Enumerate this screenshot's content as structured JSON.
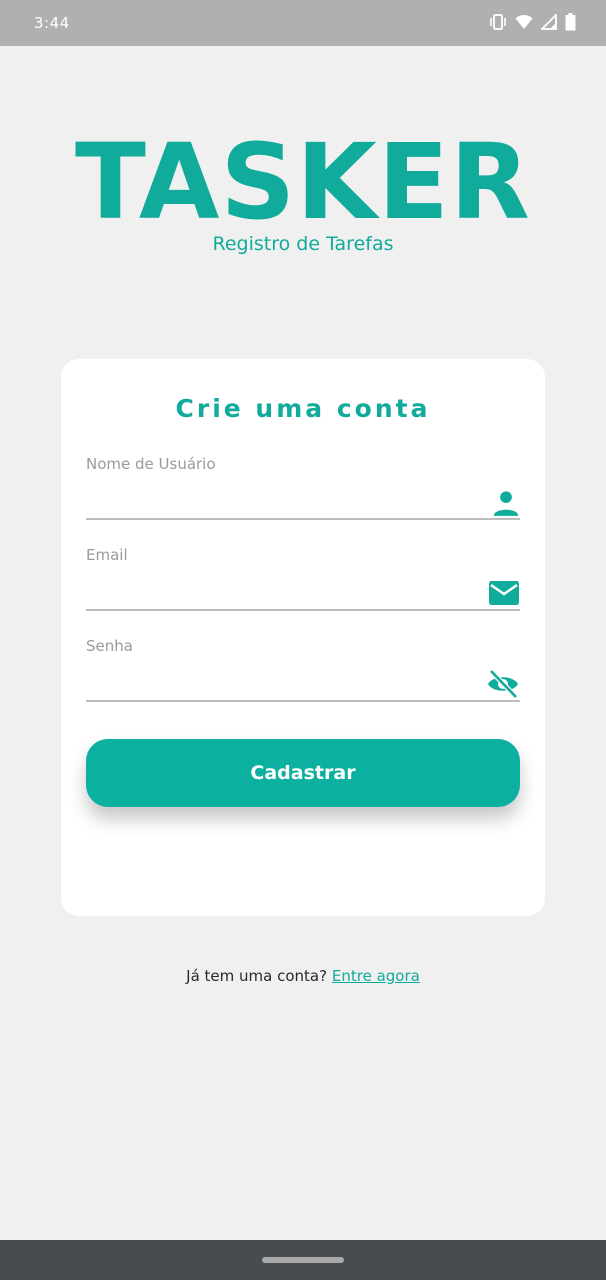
{
  "status_bar": {
    "time": "3:44",
    "icons": [
      "vibrate-icon",
      "wifi-icon",
      "signal-icon",
      "battery-icon"
    ]
  },
  "header": {
    "logo": "TASKER",
    "subtitle": "Registro de Tarefas"
  },
  "form": {
    "title": "Crie uma conta",
    "fields": [
      {
        "label": "Nome de Usuário",
        "value": "",
        "icon": "person-icon"
      },
      {
        "label": "Email",
        "value": "",
        "icon": "email-icon"
      },
      {
        "label": "Senha",
        "value": "",
        "icon": "visibility-off-icon"
      }
    ],
    "submit_label": "Cadastrar"
  },
  "footer": {
    "prompt": "Já tem uma conta?",
    "link": "Entre agora"
  },
  "colors": {
    "accent": "#11ab9c",
    "button": "#0cb0a0",
    "background": "#f0f0f0"
  }
}
